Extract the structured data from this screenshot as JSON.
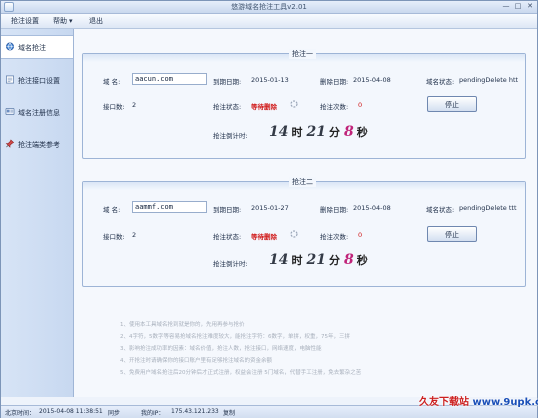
{
  "window": {
    "title": "悠游域名抢注工具v2.01",
    "minimize": "—",
    "maximize": "□",
    "close": "✕"
  },
  "menu": {
    "items": [
      "抢注设置",
      "帮助",
      "退出"
    ],
    "help_arrow": "▾"
  },
  "sidebar": {
    "items": [
      {
        "label": "域名抢注",
        "icon": "globe-icon",
        "active": true
      },
      {
        "label": "抢注接口设置",
        "icon": "settings-page-icon",
        "active": false
      },
      {
        "label": "域名注册信息",
        "icon": "info-card-icon",
        "active": false
      },
      {
        "label": "抢注端类参考",
        "icon": "pin-icon",
        "active": false
      }
    ]
  },
  "panels": [
    {
      "legend": "抢注一",
      "domain_label": "域  名:",
      "domain_value": "aacun.com",
      "expire_label": "到期日期:",
      "expire_value": "2015-01-13",
      "delete_label": "删除日期:",
      "delete_value": "2015-04-08",
      "status_label": "域名状态:",
      "status_value": "pendingDelete htt",
      "interface_label": "接口数:",
      "interface_value": "2",
      "grab_status_label": "抢注状态:",
      "grab_status_value": "等待删除",
      "grab_count_label": "抢注次数:",
      "grab_count_value": "0",
      "stop_button": "停止",
      "countdown_label": "抢注倒计时:",
      "countdown": {
        "h": "14",
        "h_unit": "时",
        "m": "21",
        "m_unit": "分",
        "s": "8",
        "s_unit": "秒"
      }
    },
    {
      "legend": "抢注二",
      "domain_label": "域  名:",
      "domain_value": "aammf.com",
      "expire_label": "到期日期:",
      "expire_value": "2015-01-27",
      "delete_label": "删除日期:",
      "delete_value": "2015-04-08",
      "status_label": "域名状态:",
      "status_value": "pendingDelete ttt",
      "interface_label": "接口数:",
      "interface_value": "2",
      "grab_status_label": "抢注状态:",
      "grab_status_value": "等待删除",
      "grab_count_label": "抢注次数:",
      "grab_count_value": "0",
      "stop_button": "停止",
      "countdown_label": "抢注倒计时:",
      "countdown": {
        "h": "14",
        "h_unit": "时",
        "m": "21",
        "m_unit": "分",
        "s": "8",
        "s_unit": "秒"
      }
    }
  ],
  "notes": [
    "1、使用本工具域名抢到就是你的，先用再参与抢价",
    "2、4字符，5数字等容易抢域名抢注难度较大，能抢注字符：6数字，单拼，权重，75年，三拼",
    "3、影响抢注成功率的因素：域名价值，抢注人数，抢注接口，网络速度，电脑性能",
    "4、开抢注时请确保你的接口账户里有足够抢注域名的资金余额",
    "5、免费用户域名抢注后20分钟后才正式注册，权益会注册 5门域名，代替手工注册，免去繁杂之苦"
  ],
  "statusbar": {
    "time_label": "北京时间：",
    "time_value": "2015-04-08 11:38:51",
    "sync": "同步",
    "ip_label": "我的IP：",
    "ip_value": "175.43.121.233",
    "copy": "复制"
  },
  "watermark": {
    "cn": "久友下载站",
    "en": "www.9upk.com"
  },
  "colors": {
    "accent_red": "#d01818",
    "timer_pink": "#c0247a",
    "panel_border": "#9db4d6"
  }
}
